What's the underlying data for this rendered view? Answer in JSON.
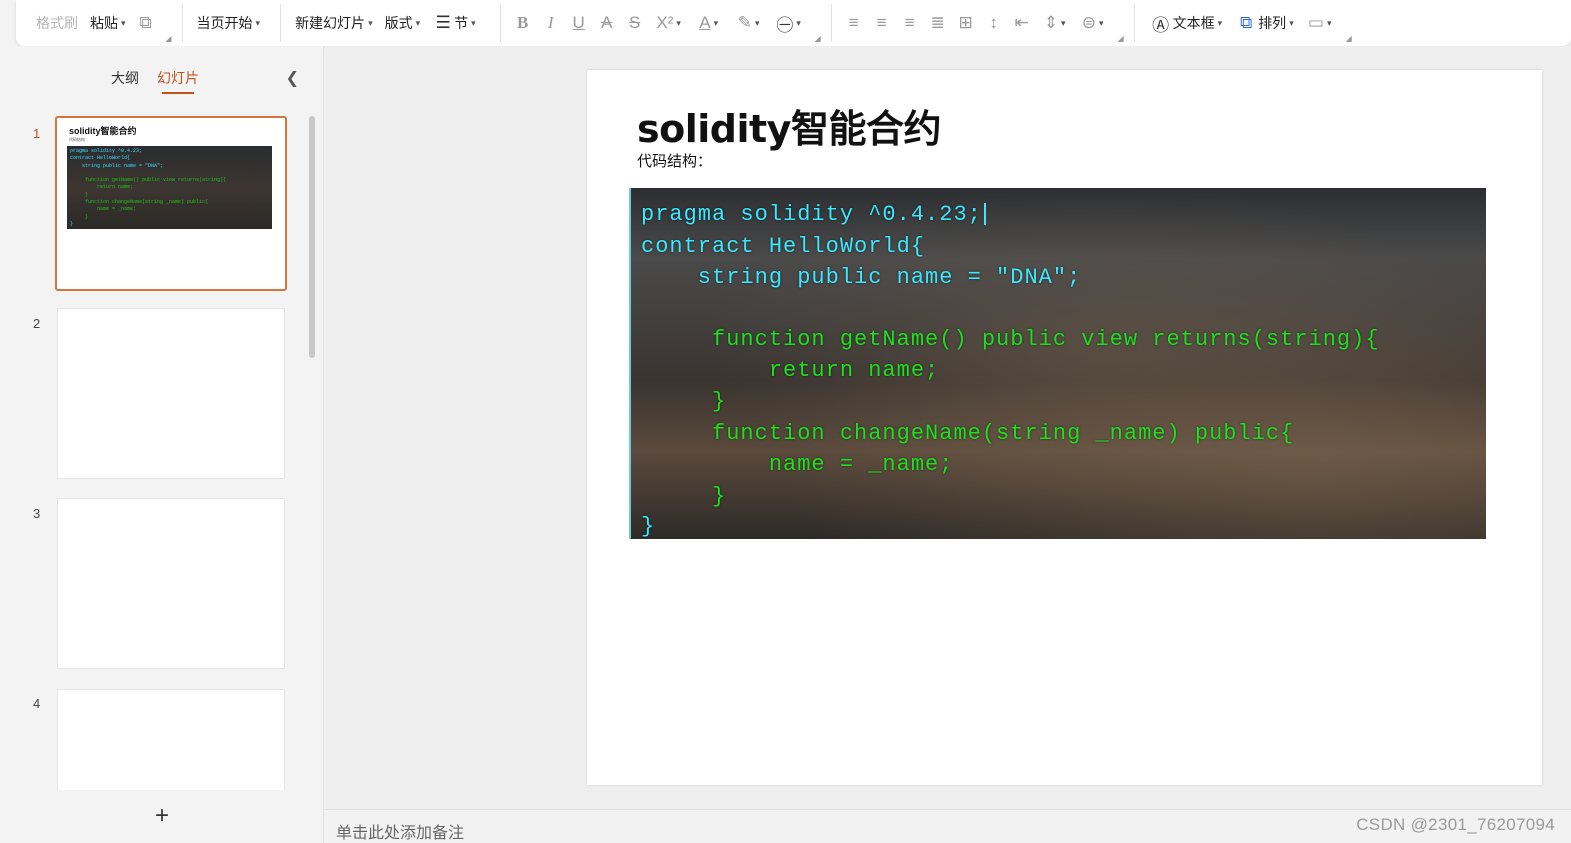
{
  "ribbon": {
    "format_painter": "格式刷",
    "paste": "粘贴",
    "from_current": "当页开始",
    "new_slide": "新建幻灯片",
    "layout": "版式",
    "section": "节",
    "superscript": "X²",
    "text_box": "文本框",
    "arrange": "排列"
  },
  "panel": {
    "tab_outline": "大纲",
    "tab_slides": "幻灯片",
    "slide_numbers": [
      "1",
      "2",
      "3",
      "4"
    ],
    "thumb1_title": "solidity智能合约",
    "thumb1_subtitle": "代码结构："
  },
  "slide": {
    "title": "solidity智能合约",
    "subtitle": "代码结构：",
    "code_lines": [
      "pragma solidity ^0.4.23;",
      "contract HelloWorld{",
      "    string public name = \"DNA\";",
      "",
      "     function getName() public view returns(string){",
      "         return name;",
      "     }",
      "     function changeName(string _name) public{",
      "         name = _name;",
      "     }",
      "}"
    ]
  },
  "notes": {
    "placeholder": "单击此处添加备注"
  },
  "watermark": "CSDN @2301_76207094",
  "colors": {
    "accent": "#c0531b",
    "code_cyan": "#3ce8ff",
    "code_green": "#1fe01f"
  }
}
